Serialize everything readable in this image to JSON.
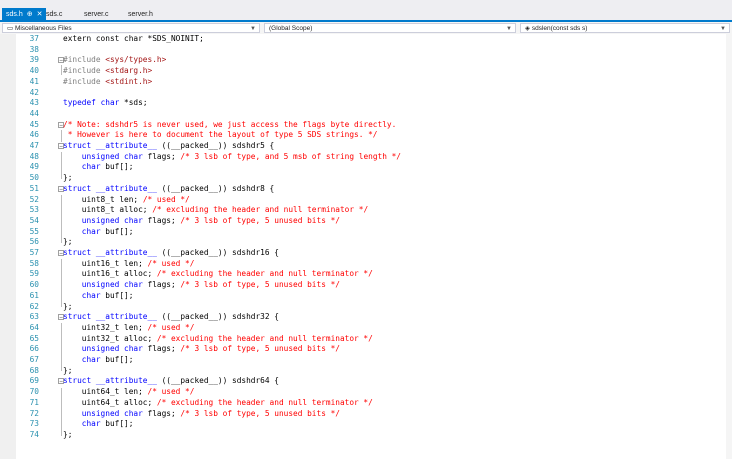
{
  "tabs": [
    {
      "label": "sds.h",
      "active": true
    },
    {
      "label": "sds.c",
      "active": false
    },
    {
      "label": "server.c",
      "active": false
    },
    {
      "label": "server.h",
      "active": false
    }
  ],
  "nav": {
    "project": "Miscellaneous Files",
    "scope": "(Global Scope)",
    "member": "sdslen(const sds s)"
  },
  "colors": {
    "accent": "#007acc",
    "keyword": "#0000ff",
    "comment": "#ff0000",
    "line_number": "#2b91af"
  },
  "lines": [
    {
      "n": "37",
      "parts": [
        [
          "p",
          "extern const char *SDS_NOINIT;"
        ]
      ]
    },
    {
      "n": "38",
      "parts": []
    },
    {
      "n": "39",
      "fold": true,
      "parts": [
        [
          "pp",
          "#include "
        ],
        [
          "str",
          "<sys/types.h>"
        ]
      ]
    },
    {
      "n": "40",
      "parts": [
        [
          "pp",
          "#include "
        ],
        [
          "str",
          "<stdarg.h>"
        ]
      ]
    },
    {
      "n": "41",
      "parts": [
        [
          "pp",
          "#include "
        ],
        [
          "str",
          "<stdint.h>"
        ]
      ]
    },
    {
      "n": "42",
      "parts": []
    },
    {
      "n": "43",
      "parts": [
        [
          "kw",
          "typedef "
        ],
        [
          "kw",
          "char"
        ],
        [
          "p",
          " *sds;"
        ]
      ]
    },
    {
      "n": "44",
      "parts": []
    },
    {
      "n": "45",
      "fold": true,
      "parts": [
        [
          "cm",
          "/* Note: sdshdr5 is never used, we just access the flags byte directly."
        ]
      ]
    },
    {
      "n": "46",
      "parts": [
        [
          "cm",
          " * However is here to document the layout of type 5 SDS strings. */"
        ]
      ]
    },
    {
      "n": "47",
      "fold": true,
      "parts": [
        [
          "kw",
          "struct "
        ],
        [
          "kw",
          "__attribute__"
        ],
        [
          "p",
          " ((__packed__)) sdshdr5 {"
        ]
      ]
    },
    {
      "n": "48",
      "parts": [
        [
          "p",
          "    "
        ],
        [
          "kw",
          "unsigned char"
        ],
        [
          "p",
          " flags; "
        ],
        [
          "cm",
          "/* 3 lsb of type, and 5 msb of string length */"
        ]
      ]
    },
    {
      "n": "49",
      "parts": [
        [
          "p",
          "    "
        ],
        [
          "kw",
          "char"
        ],
        [
          "p",
          " buf[];"
        ]
      ]
    },
    {
      "n": "50",
      "parts": [
        [
          "p",
          "};"
        ]
      ]
    },
    {
      "n": "51",
      "fold": true,
      "parts": [
        [
          "kw",
          "struct "
        ],
        [
          "kw",
          "__attribute__"
        ],
        [
          "p",
          " ((__packed__)) sdshdr8 {"
        ]
      ]
    },
    {
      "n": "52",
      "parts": [
        [
          "p",
          "    uint8_t len; "
        ],
        [
          "cm",
          "/* used */"
        ]
      ]
    },
    {
      "n": "53",
      "parts": [
        [
          "p",
          "    uint8_t alloc; "
        ],
        [
          "cm",
          "/* excluding the header and null terminator */"
        ]
      ]
    },
    {
      "n": "54",
      "parts": [
        [
          "p",
          "    "
        ],
        [
          "kw",
          "unsigned char"
        ],
        [
          "p",
          " flags; "
        ],
        [
          "cm",
          "/* 3 lsb of type, 5 unused bits */"
        ]
      ]
    },
    {
      "n": "55",
      "parts": [
        [
          "p",
          "    "
        ],
        [
          "kw",
          "char"
        ],
        [
          "p",
          " buf[];"
        ]
      ]
    },
    {
      "n": "56",
      "parts": [
        [
          "p",
          "};"
        ]
      ]
    },
    {
      "n": "57",
      "fold": true,
      "parts": [
        [
          "kw",
          "struct "
        ],
        [
          "kw",
          "__attribute__"
        ],
        [
          "p",
          " ((__packed__)) sdshdr16 {"
        ]
      ]
    },
    {
      "n": "58",
      "parts": [
        [
          "p",
          "    uint16_t len; "
        ],
        [
          "cm",
          "/* used */"
        ]
      ]
    },
    {
      "n": "59",
      "parts": [
        [
          "p",
          "    uint16_t alloc; "
        ],
        [
          "cm",
          "/* excluding the header and null terminator */"
        ]
      ]
    },
    {
      "n": "60",
      "parts": [
        [
          "p",
          "    "
        ],
        [
          "kw",
          "unsigned char"
        ],
        [
          "p",
          " flags; "
        ],
        [
          "cm",
          "/* 3 lsb of type, 5 unused bits */"
        ]
      ]
    },
    {
      "n": "61",
      "parts": [
        [
          "p",
          "    "
        ],
        [
          "kw",
          "char"
        ],
        [
          "p",
          " buf[];"
        ]
      ]
    },
    {
      "n": "62",
      "parts": [
        [
          "p",
          "};"
        ]
      ]
    },
    {
      "n": "63",
      "fold": true,
      "parts": [
        [
          "kw",
          "struct "
        ],
        [
          "kw",
          "__attribute__"
        ],
        [
          "p",
          " ((__packed__)) sdshdr32 {"
        ]
      ]
    },
    {
      "n": "64",
      "parts": [
        [
          "p",
          "    uint32_t len; "
        ],
        [
          "cm",
          "/* used */"
        ]
      ]
    },
    {
      "n": "65",
      "parts": [
        [
          "p",
          "    uint32_t alloc; "
        ],
        [
          "cm",
          "/* excluding the header and null terminator */"
        ]
      ]
    },
    {
      "n": "66",
      "parts": [
        [
          "p",
          "    "
        ],
        [
          "kw",
          "unsigned char"
        ],
        [
          "p",
          " flags; "
        ],
        [
          "cm",
          "/* 3 lsb of type, 5 unused bits */"
        ]
      ]
    },
    {
      "n": "67",
      "parts": [
        [
          "p",
          "    "
        ],
        [
          "kw",
          "char"
        ],
        [
          "p",
          " buf[];"
        ]
      ]
    },
    {
      "n": "68",
      "parts": [
        [
          "p",
          "};"
        ]
      ]
    },
    {
      "n": "69",
      "fold": true,
      "parts": [
        [
          "kw",
          "struct "
        ],
        [
          "kw",
          "__attribute__"
        ],
        [
          "p",
          " ((__packed__)) sdshdr64 {"
        ]
      ]
    },
    {
      "n": "70",
      "parts": [
        [
          "p",
          "    uint64_t len; "
        ],
        [
          "cm",
          "/* used */"
        ]
      ]
    },
    {
      "n": "71",
      "parts": [
        [
          "p",
          "    uint64_t alloc; "
        ],
        [
          "cm",
          "/* excluding the header and null terminator */"
        ]
      ]
    },
    {
      "n": "72",
      "parts": [
        [
          "p",
          "    "
        ],
        [
          "kw",
          "unsigned char"
        ],
        [
          "p",
          " flags; "
        ],
        [
          "cm",
          "/* 3 lsb of type, 5 unused bits */"
        ]
      ]
    },
    {
      "n": "73",
      "parts": [
        [
          "p",
          "    "
        ],
        [
          "kw",
          "char"
        ],
        [
          "p",
          " buf[];"
        ]
      ]
    },
    {
      "n": "74",
      "parts": [
        [
          "p",
          "};"
        ]
      ]
    }
  ]
}
